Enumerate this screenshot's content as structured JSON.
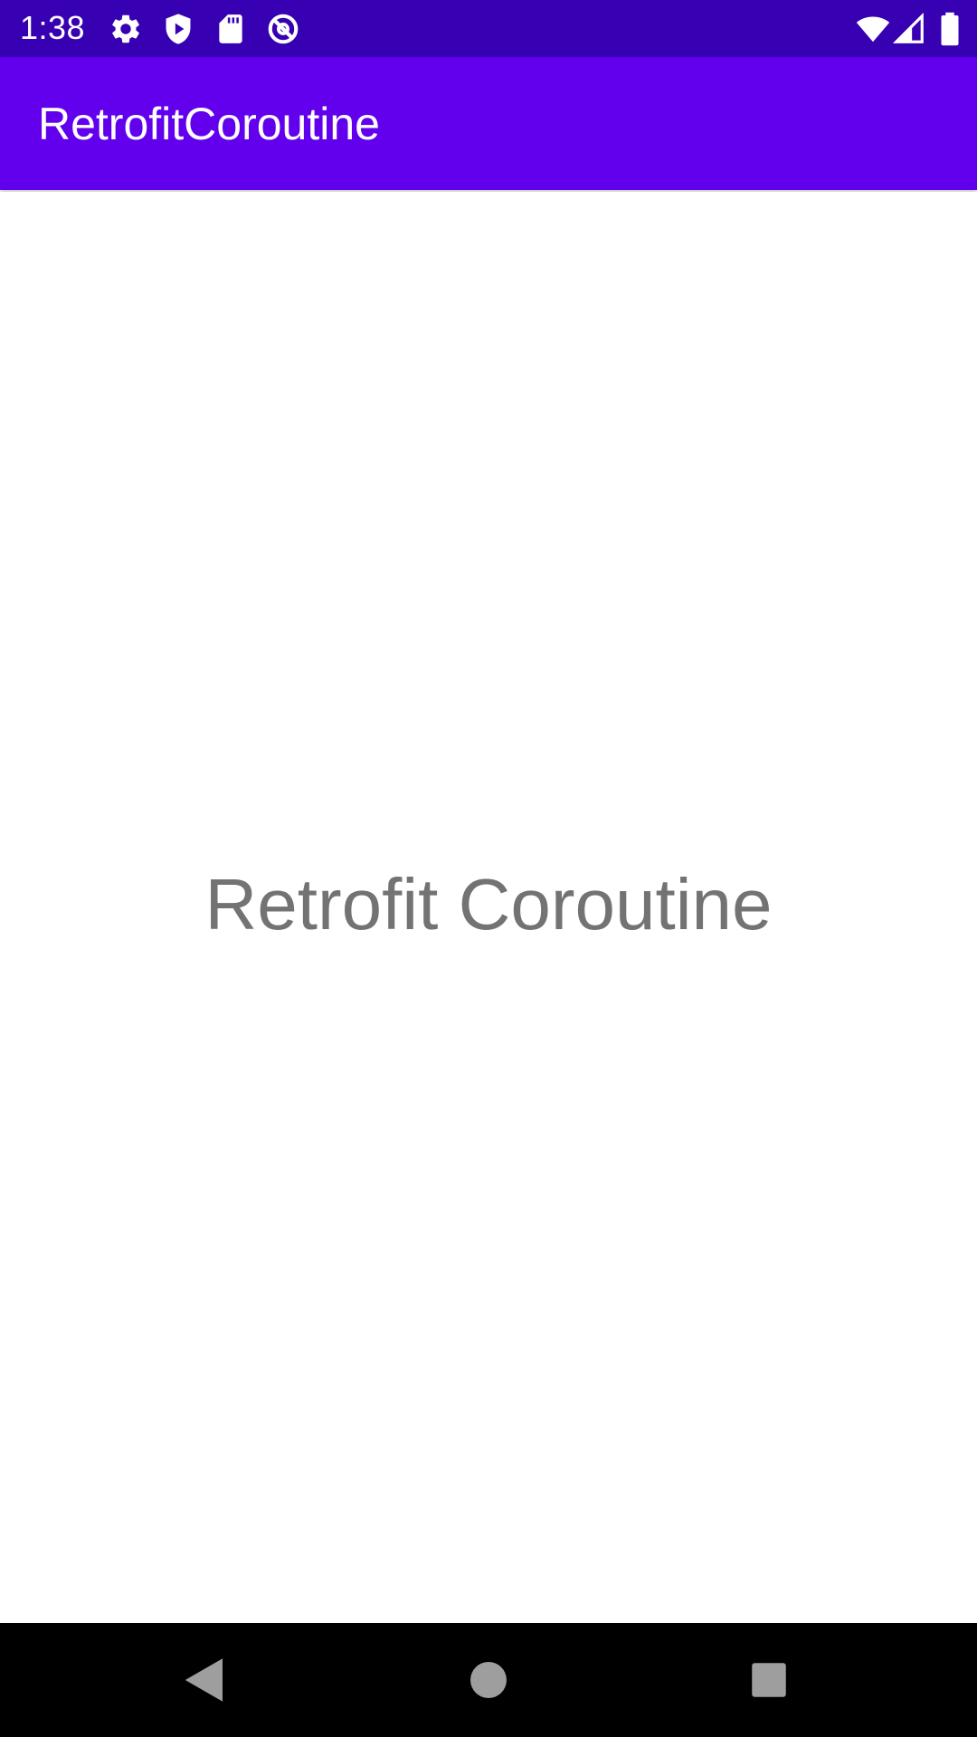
{
  "status_bar": {
    "time": "1:38",
    "left_icons": [
      "gear-icon",
      "play-protect-icon",
      "sd-card-icon",
      "no-entry-icon"
    ],
    "right_icons": [
      "wifi-icon",
      "cell-signal-icon",
      "battery-icon"
    ],
    "background": "#3700B3"
  },
  "app_bar": {
    "title": "RetrofitCoroutine",
    "background": "#6200EE"
  },
  "main": {
    "text": "Retrofit Coroutine",
    "text_color": "#737373"
  },
  "nav_bar": {
    "buttons": [
      "back-icon",
      "home-icon",
      "recents-icon"
    ],
    "background": "#000000"
  }
}
